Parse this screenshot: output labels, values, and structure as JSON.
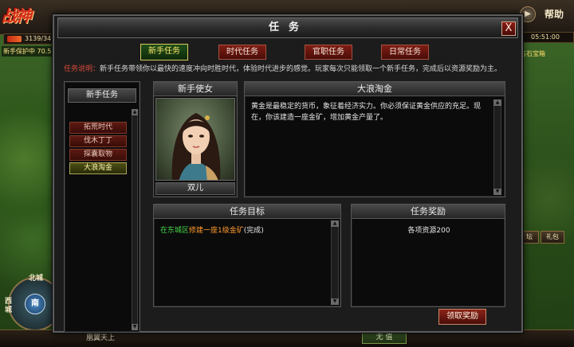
{
  "hud": {
    "game_logo": "战神",
    "hp_readout": "3139/34",
    "quest_tracker": "新手保护中 70.5",
    "help_label": "帮助",
    "time": "05:51:00",
    "right_label": "占石宝箱",
    "side_button_left": "坛",
    "side_button_right": "礼包",
    "compass": {
      "north": "北城",
      "west": "西城",
      "south": "南城",
      "center": "南"
    },
    "bottom_text": "凰翼天上",
    "bottom_pill": "无 值"
  },
  "dialog": {
    "title": "任务",
    "close_label": "X",
    "tabs": [
      {
        "label": "新手任务",
        "active": true
      },
      {
        "label": "时代任务",
        "active": false
      },
      {
        "label": "官职任务",
        "active": false
      },
      {
        "label": "日常任务",
        "active": false
      }
    ],
    "description_label": "任务说明：",
    "description": "新手任务带领你以最快的速度冲向时胜时代，体验时代进步的感觉。玩家每次只能领取一个新手任务，完成后以资源奖励为主。",
    "quest_list": {
      "header": "新手任务",
      "items": [
        {
          "label": "拓荒时代",
          "active": false
        },
        {
          "label": "伐木丁丁",
          "active": false
        },
        {
          "label": "探囊取物",
          "active": false
        },
        {
          "label": "大浪淘金",
          "active": true
        }
      ]
    },
    "npc": {
      "header": "新手使女",
      "name": "双儿"
    },
    "story": {
      "header": "大浪淘金",
      "text": "黄金是最稳定的货币，象征着经济实力。你必须保证黄金供应的充足。现在，你该建造一座金矿，增加黄金产量了。"
    },
    "objective": {
      "header": "任务目标",
      "part1": "在东城区",
      "part2": "修建一座1级金矿",
      "part3": "(完成)"
    },
    "reward": {
      "header": "任务奖励",
      "text": "各项资源200"
    },
    "claim_button": "领取奖励"
  }
}
